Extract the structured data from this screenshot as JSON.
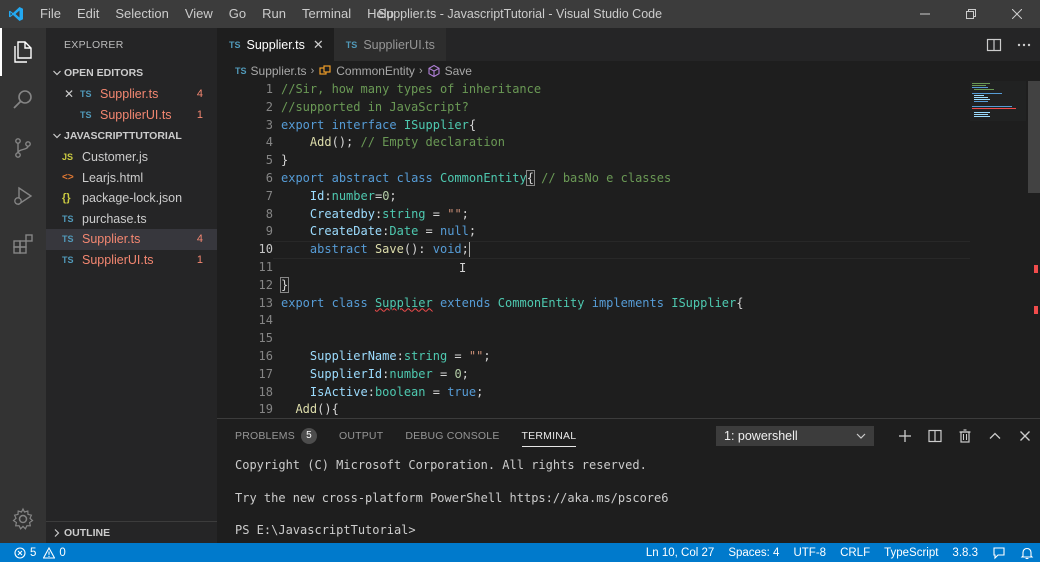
{
  "window": {
    "title": "Supplier.ts - JavascriptTutorial - Visual Studio Code",
    "menu": [
      "File",
      "Edit",
      "Selection",
      "View",
      "Go",
      "Run",
      "Terminal",
      "Help"
    ]
  },
  "sidebar": {
    "title": "EXPLORER",
    "open_editors": {
      "label": "OPEN EDITORS",
      "items": [
        {
          "icon": "TS",
          "name": "Supplier.ts",
          "badge": "4",
          "close": "✕"
        },
        {
          "icon": "TS",
          "name": "SupplierUI.ts",
          "badge": "1"
        }
      ]
    },
    "project": {
      "label": "JAVASCRIPTTUTORIAL",
      "items": [
        {
          "icon": "JS",
          "name": "Customer.js"
        },
        {
          "icon": "<>",
          "name": "Learjs.html"
        },
        {
          "icon": "{}",
          "name": "package-lock.json"
        },
        {
          "icon": "TS",
          "name": "purchase.ts"
        },
        {
          "icon": "TS",
          "name": "Supplier.ts",
          "badge": "4"
        },
        {
          "icon": "TS",
          "name": "SupplierUI.ts",
          "badge": "1"
        }
      ]
    },
    "outline_label": "OUTLINE"
  },
  "editor": {
    "tabs": [
      {
        "icon": "TS",
        "label": "Supplier.ts",
        "close": "✕"
      },
      {
        "icon": "TS",
        "label": "SupplierUI.ts"
      }
    ],
    "breadcrumb": {
      "file_icon": "TS",
      "file": "Supplier.ts",
      "sep": "›",
      "class": "CommonEntity",
      "method": "Save"
    },
    "line_numbers": [
      "1",
      "2",
      "3",
      "4",
      "5",
      "6",
      "7",
      "8",
      "9",
      "10",
      "11",
      "12",
      "13",
      "14",
      "15",
      "16",
      "17",
      "18",
      "19"
    ],
    "current_line": "10"
  },
  "panel": {
    "tabs": {
      "problems": "PROBLEMS",
      "problems_count": "5",
      "output": "OUTPUT",
      "debug": "DEBUG CONSOLE",
      "terminal": "TERMINAL"
    },
    "terminal_select": "1: powershell",
    "terminal_lines": [
      "Copyright (C) Microsoft Corporation. All rights reserved.",
      "",
      "Try the new cross-platform PowerShell https://aka.ms/pscore6",
      "",
      "PS E:\\JavascriptTutorial>"
    ]
  },
  "statusbar": {
    "errors": "5",
    "warnings": "0",
    "position": "Ln 10, Col 27",
    "spaces": "Spaces: 4",
    "encoding": "UTF-8",
    "eol": "CRLF",
    "language": "TypeScript",
    "version": "3.8.3"
  },
  "colors": {
    "accent": "#007acc",
    "error_text": "#f48771",
    "titlebar": "#3c3c3c",
    "sidebar": "#252526",
    "editor": "#1e1e1e"
  }
}
